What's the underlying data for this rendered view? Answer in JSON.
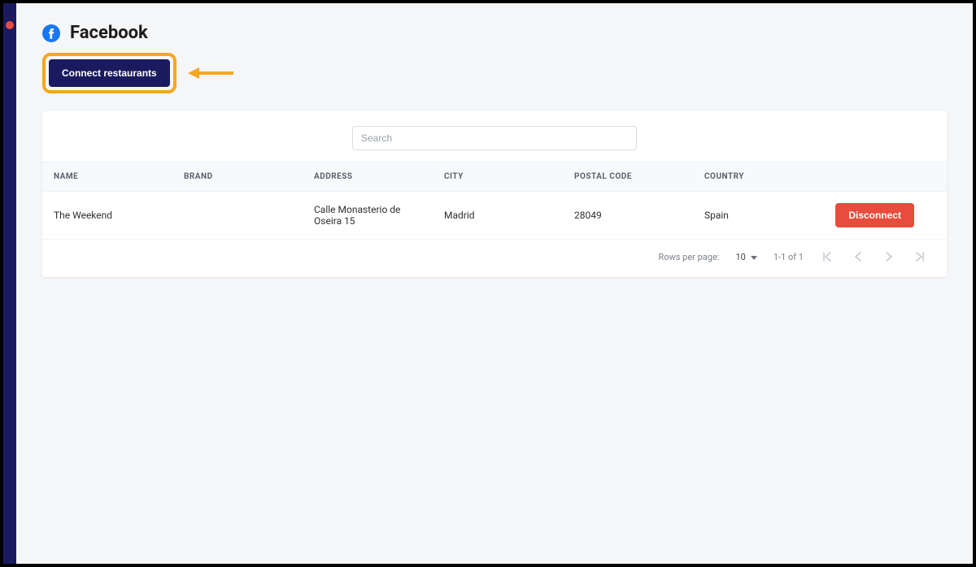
{
  "header": {
    "title": "Facebook",
    "connect_button": "Connect restaurants"
  },
  "search": {
    "placeholder": "Search"
  },
  "table": {
    "columns": {
      "name": "NAME",
      "brand": "BRAND",
      "address": "ADDRESS",
      "city": "CITY",
      "postal": "POSTAL CODE",
      "country": "COUNTRY"
    },
    "rows": [
      {
        "name": "The Weekend",
        "brand": "",
        "address": "Calle Monasterio de Oseira 15",
        "city": "Madrid",
        "postal": "28049",
        "country": "Spain",
        "action_label": "Disconnect"
      }
    ]
  },
  "pagination": {
    "rows_label": "Rows per page:",
    "rows_value": "10",
    "range": "1-1 of 1"
  },
  "colors": {
    "primary": "#1a1b5e",
    "highlight": "#f5a623",
    "danger": "#e74c3c",
    "facebook": "#1877f2"
  }
}
